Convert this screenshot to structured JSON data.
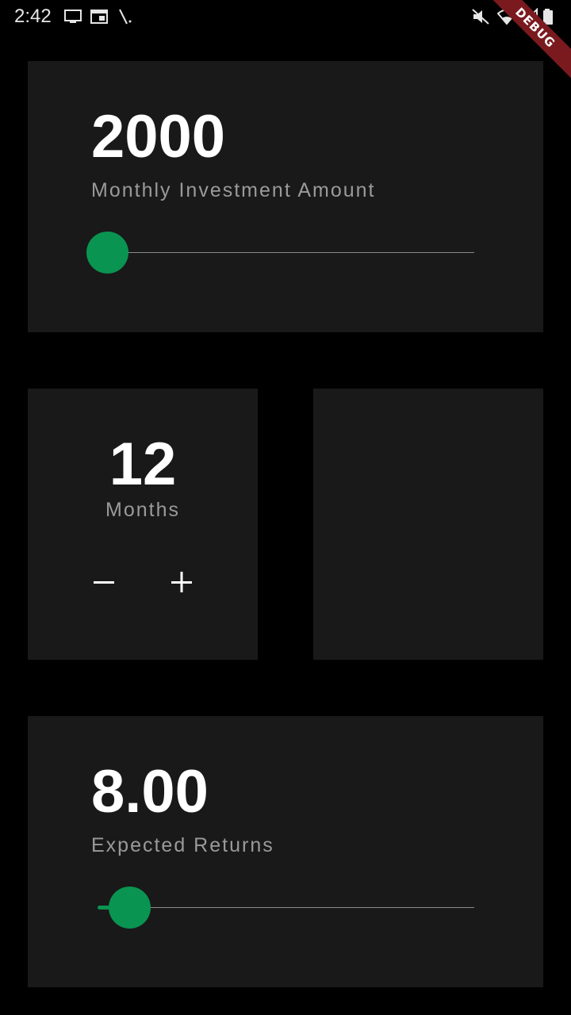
{
  "status_bar": {
    "time": "2:42",
    "left_icons": [
      "monitor-icon",
      "calendar-icon",
      "signal-slash-icon"
    ],
    "right_icons": [
      "mute-vibrate-icon",
      "wifi-icon",
      "cell-signal-icon",
      "battery-icon"
    ],
    "debug_banner": "DEBUG"
  },
  "investment": {
    "value": "2000",
    "label": "Monthly Investment Amount",
    "slider_fraction": 0.0
  },
  "duration": {
    "value": "12",
    "label": "Months",
    "decrement_icon": "minus-icon",
    "increment_icon": "plus-icon"
  },
  "returns": {
    "value": "8.00",
    "label": "Expected Returns",
    "slider_fraction": 0.06
  },
  "colors": {
    "background": "#000000",
    "card": "#191919",
    "accent": "#0a9451",
    "label": "#9a9a9a",
    "debug_banner": "#7a1a1f"
  }
}
